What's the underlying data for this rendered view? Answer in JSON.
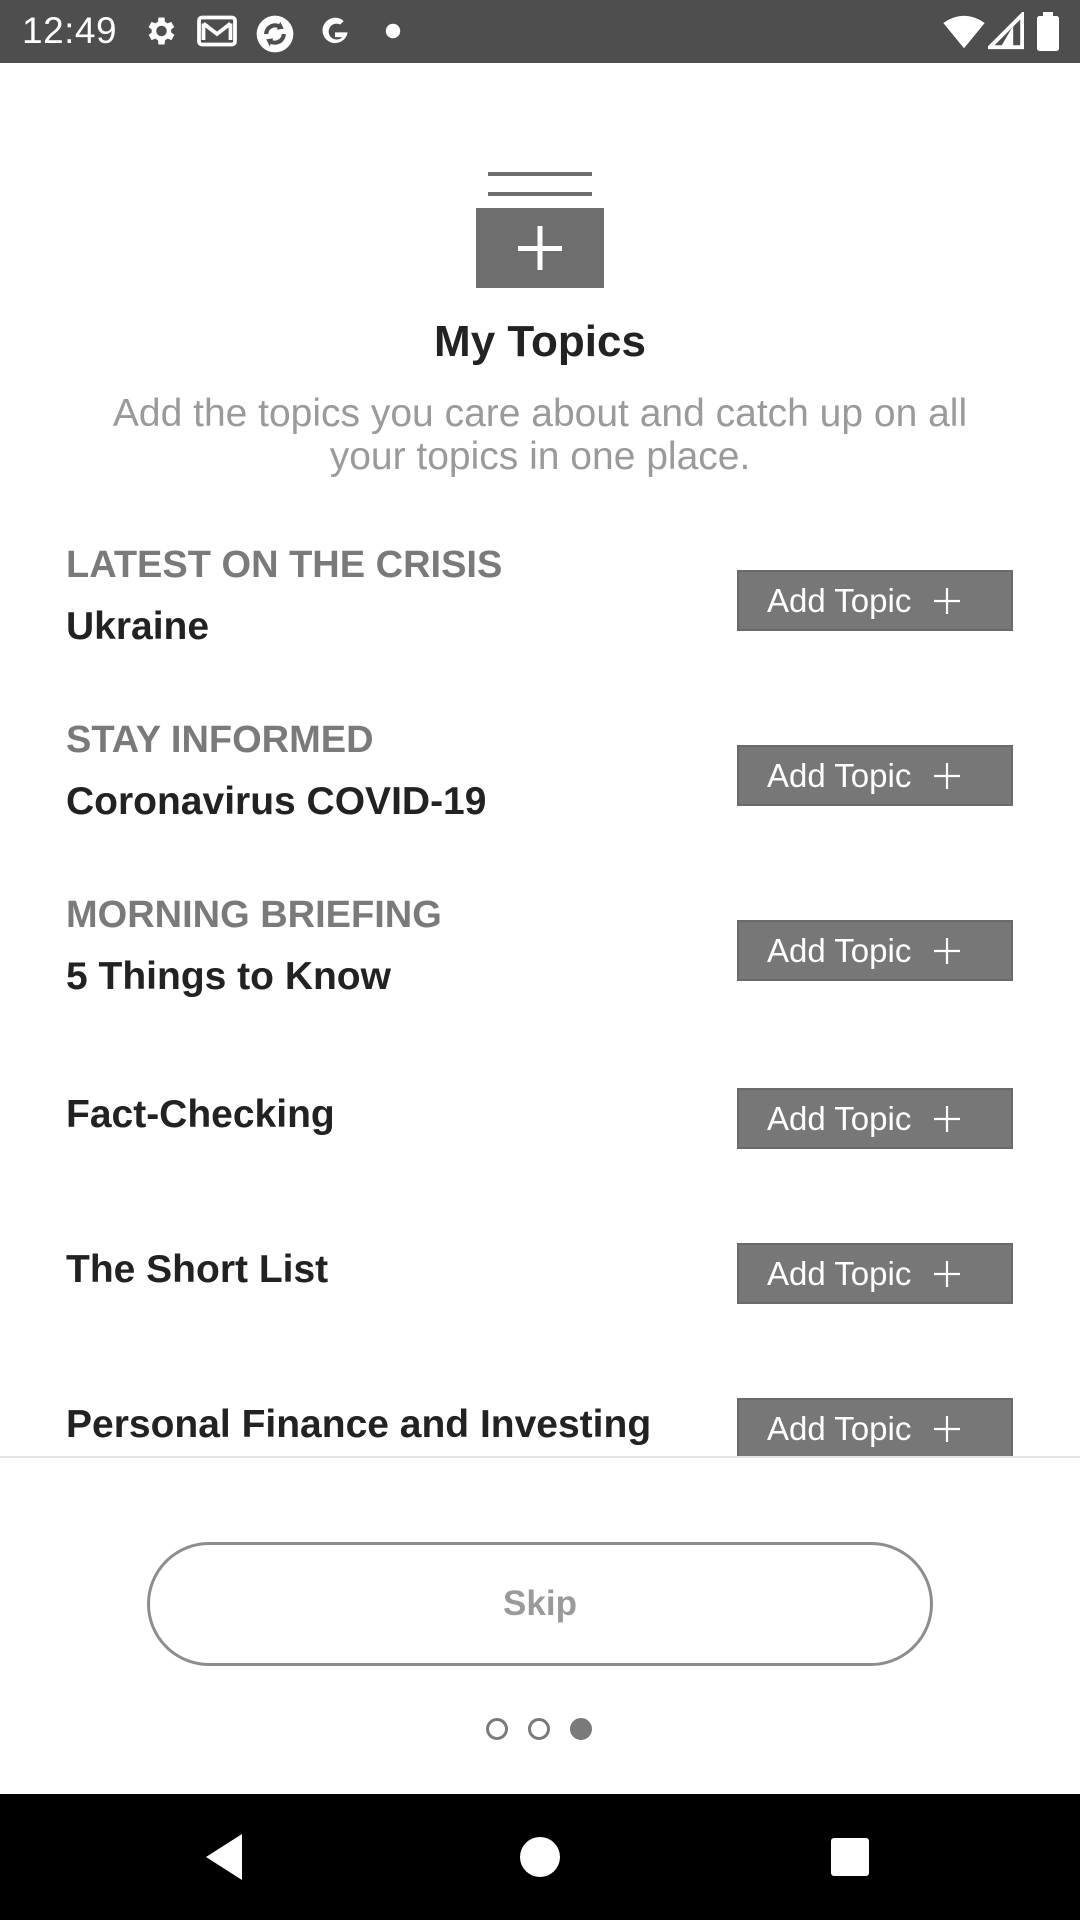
{
  "status_bar": {
    "time": "12:49",
    "left_icons": [
      "gear-icon",
      "mail-icon",
      "sync-icon",
      "g-icon",
      "dot-icon"
    ],
    "right_icons": [
      "wifi-icon",
      "signal-icon",
      "battery-icon"
    ]
  },
  "header": {
    "icon": "add-topic-folder-icon",
    "title": "My Topics",
    "subtitle": "Add the topics you care about and catch up on all your topics in one place."
  },
  "topics": [
    {
      "kicker": "LATEST ON THE CRISIS",
      "name": "Ukraine",
      "button_label": "Add Topic"
    },
    {
      "kicker": "STAY INFORMED",
      "name": "Coronavirus COVID-19",
      "button_label": "Add Topic"
    },
    {
      "kicker": "MORNING BRIEFING",
      "name": "5 Things to Know",
      "button_label": "Add Topic"
    },
    {
      "kicker": "",
      "name": "Fact-Checking",
      "button_label": "Add Topic"
    },
    {
      "kicker": "",
      "name": "The Short List",
      "button_label": "Add Topic"
    },
    {
      "kicker": "",
      "name": "Personal Finance and Investing",
      "button_label": "Add Topic"
    }
  ],
  "footer": {
    "skip_label": "Skip",
    "pager": {
      "total": 3,
      "active_index": 2
    }
  },
  "nav_bar": {
    "buttons": [
      "back-icon",
      "home-icon",
      "recents-icon"
    ]
  },
  "colors": {
    "button_bg": "#777777",
    "status_bar_bg": "#4e4e4e",
    "title_text": "#222222",
    "muted_text": "#9a9a9a"
  }
}
